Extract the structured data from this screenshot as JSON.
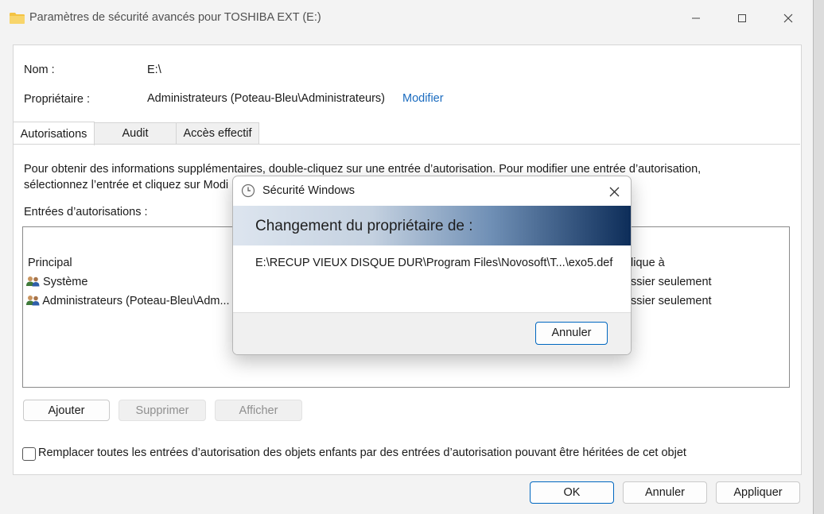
{
  "window": {
    "title": "Paramètres de sécurité avancés pour TOSHIBA EXT (E:)",
    "minimize_glyph": "–",
    "maximize_glyph": "☐",
    "close_glyph": "✕"
  },
  "info": {
    "name_label": "Nom :",
    "name_value": "E:\\",
    "owner_label": "Propriétaire :",
    "owner_value": "Administrateurs (Poteau-Bleu\\Administrateurs)",
    "owner_link": "Modifier"
  },
  "tabs": [
    {
      "label": "Autorisations",
      "active": true
    },
    {
      "label": "Audit",
      "active": false
    },
    {
      "label": "Accès effectif",
      "active": false
    }
  ],
  "instructions": {
    "line1": "Pour obtenir des informations supplémentaires, double-cliquez sur une entrée d’autorisation. Pour modifier une entrée d’autorisation,",
    "line2": "sélectionnez l’entrée et cliquez sur Modi"
  },
  "entries": {
    "label": "Entrées d’autorisations :",
    "col_principal": "Principal",
    "col_applies_partial": "lique à",
    "rows": [
      {
        "principal": "Système",
        "applies_partial": "ssier seulement",
        "icon": "users-icon"
      },
      {
        "principal": "Administrateurs (Poteau-Bleu\\Adm...",
        "applies_partial": "ssier seulement",
        "icon": "users-icon"
      }
    ]
  },
  "list_buttons": {
    "add": "Ajouter",
    "remove": "Supprimer",
    "view": "Afficher"
  },
  "replace_checkbox": {
    "label": "Remplacer toutes les entrées d’autorisation des objets enfants par des entrées d’autorisation pouvant être héritées de cet objet",
    "checked": false
  },
  "footer_buttons": {
    "ok": "OK",
    "cancel": "Annuler",
    "apply": "Appliquer"
  },
  "dialog": {
    "title": "Sécurité Windows",
    "close_glyph": "✕",
    "heading": "Changement du propriétaire de :",
    "path": "E:\\RECUP VIEUX DISQUE DUR\\Program Files\\Novosoft\\T...\\exo5.def",
    "cancel": "Annuler"
  },
  "colors": {
    "accent": "#0067c0",
    "link": "#1a6bbf",
    "banner_start": "#dde5ef",
    "banner_end": "#0d2d59"
  }
}
